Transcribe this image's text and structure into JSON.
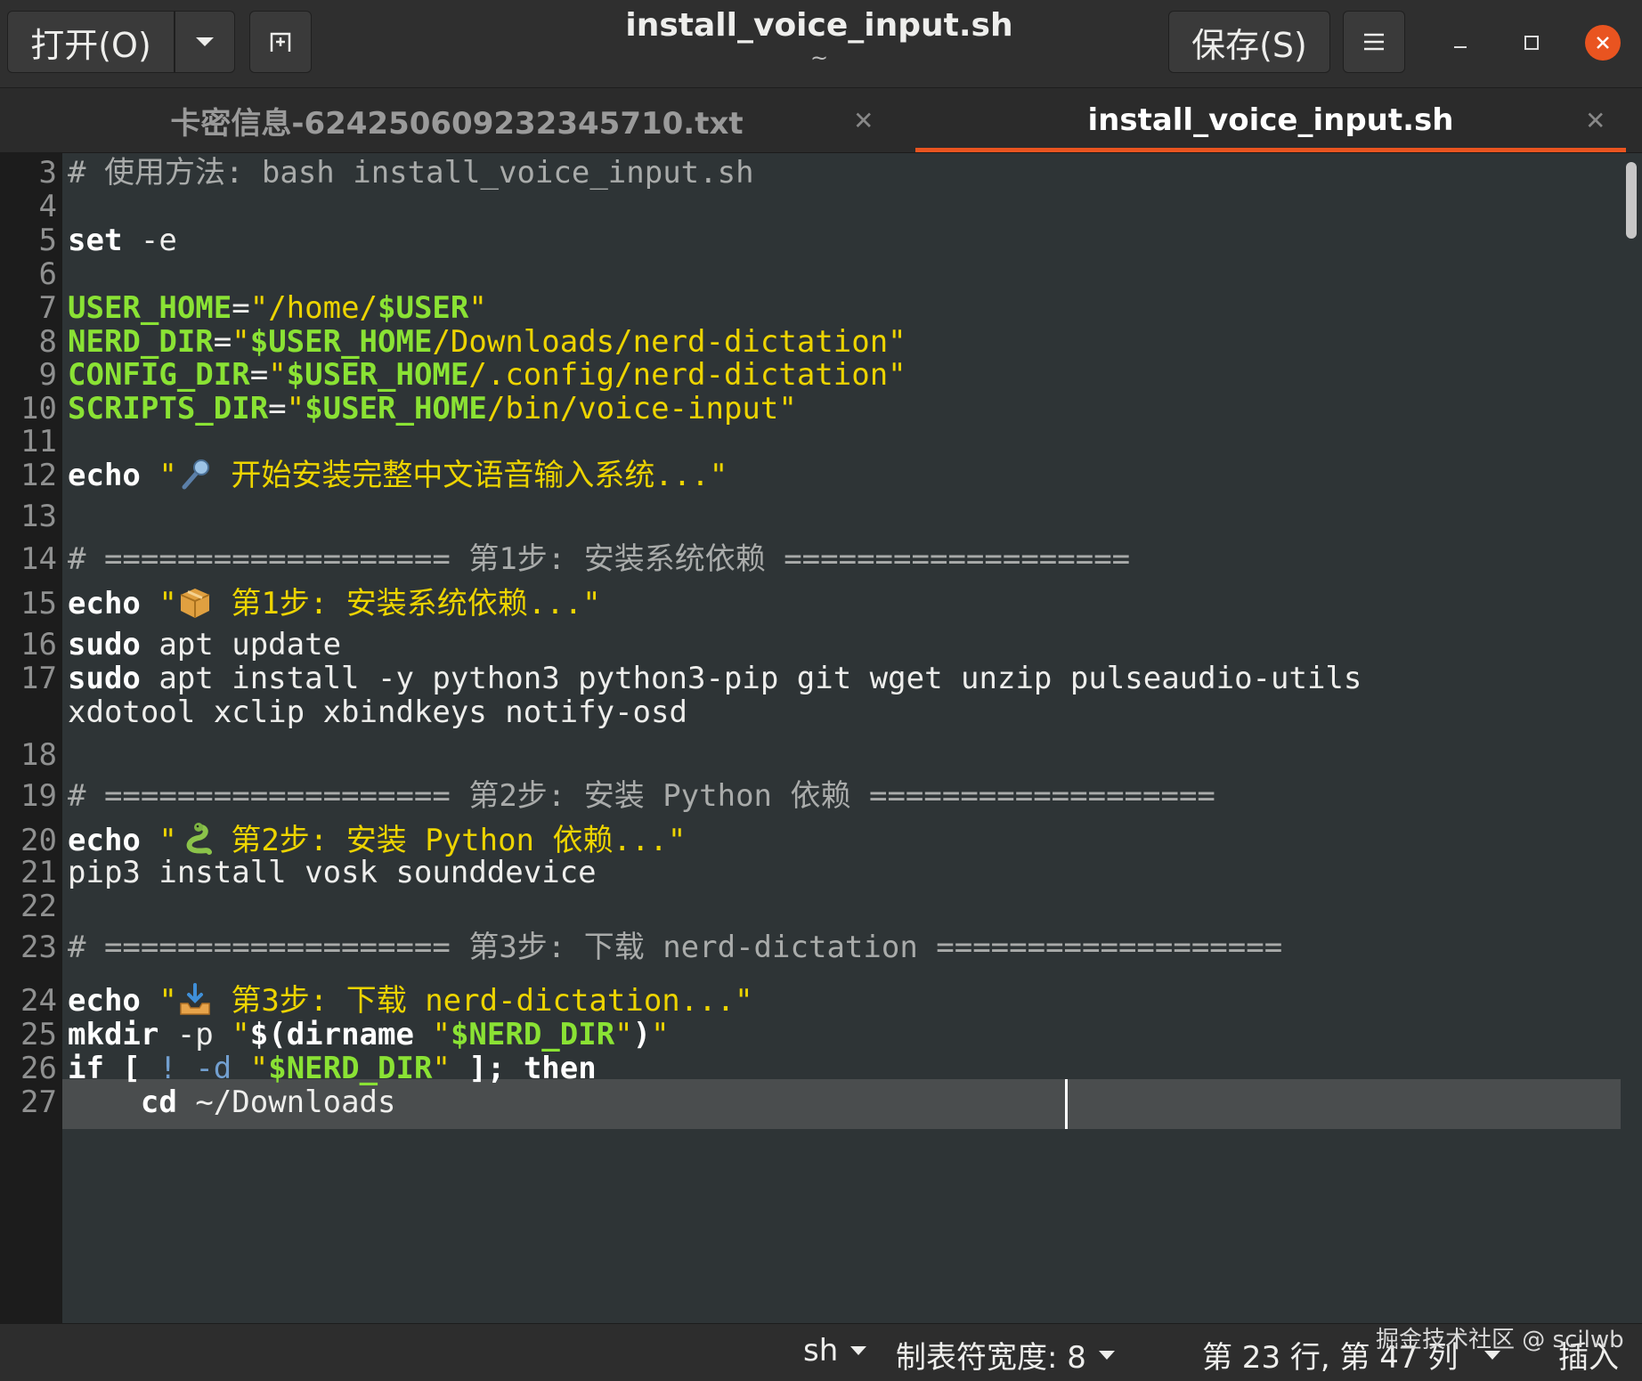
{
  "header": {
    "open_label": "打开(O)",
    "title": "install_voice_input.sh",
    "subtitle": "~",
    "save_label": "保存(S)"
  },
  "tabs": [
    {
      "label": "卡密信息-624250609232345710.txt",
      "active": false
    },
    {
      "label": "install_voice_input.sh",
      "active": true
    }
  ],
  "lines": [
    {
      "n": "3",
      "segs": [
        {
          "t": "# 使用方法: bash install_voice_input.sh",
          "c": "cm"
        }
      ]
    },
    {
      "n": "4",
      "segs": []
    },
    {
      "n": "5",
      "segs": [
        {
          "t": "set",
          "c": "kw"
        },
        {
          "t": " -e",
          "c": "pl"
        }
      ]
    },
    {
      "n": "6",
      "segs": []
    },
    {
      "n": "7",
      "segs": [
        {
          "t": "USER_HOME",
          "c": "var"
        },
        {
          "t": "=",
          "c": "pl"
        },
        {
          "t": "\"/home/",
          "c": "str"
        },
        {
          "t": "$USER",
          "c": "var"
        },
        {
          "t": "\"",
          "c": "str"
        }
      ]
    },
    {
      "n": "8",
      "segs": [
        {
          "t": "NERD_DIR",
          "c": "var"
        },
        {
          "t": "=",
          "c": "pl"
        },
        {
          "t": "\"",
          "c": "str"
        },
        {
          "t": "$USER_HOME",
          "c": "var"
        },
        {
          "t": "/Downloads/nerd-dictation\"",
          "c": "str"
        }
      ]
    },
    {
      "n": "9",
      "segs": [
        {
          "t": "CONFIG_DIR",
          "c": "var"
        },
        {
          "t": "=",
          "c": "pl"
        },
        {
          "t": "\"",
          "c": "str"
        },
        {
          "t": "$USER_HOME",
          "c": "var"
        },
        {
          "t": "/.config/nerd-dictation\"",
          "c": "str"
        }
      ]
    },
    {
      "n": "10",
      "segs": [
        {
          "t": "SCRIPTS_DIR",
          "c": "var"
        },
        {
          "t": "=",
          "c": "pl"
        },
        {
          "t": "\"",
          "c": "str"
        },
        {
          "t": "$USER_HOME",
          "c": "var"
        },
        {
          "t": "/bin/voice-input\"",
          "c": "str"
        }
      ]
    },
    {
      "n": "11",
      "segs": []
    },
    {
      "n": "12",
      "segs": [
        {
          "t": "echo",
          "c": "kw"
        },
        {
          "t": " \"",
          "c": "str"
        },
        {
          "emoji": "microphone"
        },
        {
          "t": " 开始安装完整中文语音输入系统...\"",
          "c": "str"
        }
      ]
    },
    {
      "n": "13",
      "segs": []
    },
    {
      "n": "14",
      "segs": [
        {
          "t": "# =================== 第1步: 安装系统依赖 ===================",
          "c": "cm"
        }
      ]
    },
    {
      "n": "15",
      "segs": [
        {
          "t": "echo",
          "c": "kw"
        },
        {
          "t": " \"",
          "c": "str"
        },
        {
          "emoji": "package"
        },
        {
          "t": " 第1步: 安装系统依赖...\"",
          "c": "str"
        }
      ]
    },
    {
      "n": "16",
      "segs": [
        {
          "t": "sudo",
          "c": "kw"
        },
        {
          "t": " apt update",
          "c": "pl"
        }
      ]
    },
    {
      "n": "17",
      "segs": [
        {
          "t": "sudo",
          "c": "kw"
        },
        {
          "t": " apt install -y python3 python3-pip git wget unzip pulseaudio-utils",
          "c": "pl"
        }
      ],
      "cont": "xdotool xclip xbindkeys notify-osd"
    },
    {
      "n": "18",
      "segs": []
    },
    {
      "n": "19",
      "segs": [
        {
          "t": "# =================== 第2步: 安装 Python 依赖 ===================",
          "c": "cm"
        }
      ]
    },
    {
      "n": "20",
      "segs": [
        {
          "t": "echo",
          "c": "kw"
        },
        {
          "t": " \"",
          "c": "str"
        },
        {
          "emoji": "snake"
        },
        {
          "t": " 第2步: 安装 Python 依赖...\"",
          "c": "str"
        }
      ]
    },
    {
      "n": "21",
      "segs": [
        {
          "t": "pip3 install vosk sounddevice",
          "c": "pl"
        }
      ]
    },
    {
      "n": "22",
      "segs": []
    },
    {
      "n": "23",
      "segs": [
        {
          "t": "# =================== 第3步: 下载 nerd-dictation ===================",
          "c": "cm"
        }
      ]
    },
    {
      "n": "24",
      "segs": [
        {
          "t": "echo",
          "c": "kw"
        },
        {
          "t": " \"",
          "c": "str"
        },
        {
          "emoji": "inbox-tray"
        },
        {
          "t": " 第3步: 下载 nerd-dictation...\"",
          "c": "str"
        }
      ]
    },
    {
      "n": "25",
      "segs": [
        {
          "t": "mkdir",
          "c": "kw"
        },
        {
          "t": " -p ",
          "c": "pl"
        },
        {
          "t": "\"",
          "c": "str"
        },
        {
          "t": "$(",
          "c": "kw"
        },
        {
          "t": "dirname",
          "c": "kw"
        },
        {
          "t": " \"",
          "c": "str"
        },
        {
          "t": "$NERD_DIR",
          "c": "var"
        },
        {
          "t": "\"",
          "c": "str"
        },
        {
          "t": ")",
          "c": "kw"
        },
        {
          "t": "\"",
          "c": "str"
        }
      ]
    },
    {
      "n": "26",
      "segs": [
        {
          "t": "if",
          "c": "kw"
        },
        {
          "t": " [",
          "c": "kw"
        },
        {
          "t": " ! -d ",
          "c": "op"
        },
        {
          "t": "\"",
          "c": "str"
        },
        {
          "t": "$NERD_DIR",
          "c": "var"
        },
        {
          "t": "\"",
          "c": "str"
        },
        {
          "t": " ]; then",
          "c": "kw"
        }
      ]
    },
    {
      "n": "27",
      "segs": [
        {
          "t": "    ",
          "c": "pl"
        },
        {
          "t": "cd",
          "c": "kw"
        },
        {
          "t": " ~/Downloads",
          "c": "pl"
        }
      ]
    }
  ],
  "current_line": "23",
  "status": {
    "language": "sh",
    "tab_width": "制表符宽度: 8",
    "position": "第 23 行, 第 47 列",
    "mode": "插入"
  },
  "watermark": "掘金技术社区 @ scilwb",
  "colors": {
    "accent": "#e95420",
    "comment": "#a9abaa",
    "string": "#edd400",
    "variable": "#8ae234",
    "operator": "#729fcf",
    "editor_bg": "#2e3436"
  }
}
